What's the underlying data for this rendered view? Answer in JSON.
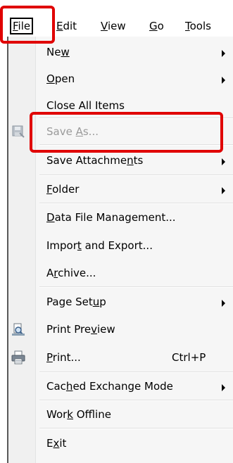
{
  "menubar": {
    "items": [
      {
        "label_pre": "",
        "label_ul": "F",
        "label_post": "ile"
      },
      {
        "label_pre": "",
        "label_ul": "E",
        "label_post": "dit"
      },
      {
        "label_pre": "",
        "label_ul": "V",
        "label_post": "iew"
      },
      {
        "label_pre": "",
        "label_ul": "G",
        "label_post": "o"
      },
      {
        "label_pre": "",
        "label_ul": "T",
        "label_post": "ools"
      }
    ]
  },
  "menu": {
    "items": [
      {
        "pre": "Ne",
        "ul": "w",
        "post": ""
      },
      {
        "pre": "",
        "ul": "O",
        "post": "pen"
      },
      {
        "pre": "Close All Items",
        "ul": "",
        "post": ""
      },
      {
        "pre": "Save ",
        "ul": "A",
        "post": "s..."
      },
      {
        "pre": "Save Attachme",
        "ul": "n",
        "post": "ts"
      },
      {
        "pre": "",
        "ul": "F",
        "post": "older"
      },
      {
        "pre": "",
        "ul": "D",
        "post": "ata File Management..."
      },
      {
        "pre": "Impor",
        "ul": "t",
        "post": " and Export..."
      },
      {
        "pre": "A",
        "ul": "r",
        "post": "chive..."
      },
      {
        "pre": "Page Set",
        "ul": "u",
        "post": "p"
      },
      {
        "pre": "Print Pre",
        "ul": "v",
        "post": "iew"
      },
      {
        "pre": "",
        "ul": "P",
        "post": "rint..."
      },
      {
        "pre": "Cac",
        "ul": "h",
        "post": "ed Exchange Mode"
      },
      {
        "pre": "Wor",
        "ul": "k",
        "post": " Offline"
      },
      {
        "pre": "E",
        "ul": "x",
        "post": "it"
      }
    ],
    "print_shortcut": "Ctrl+P"
  }
}
